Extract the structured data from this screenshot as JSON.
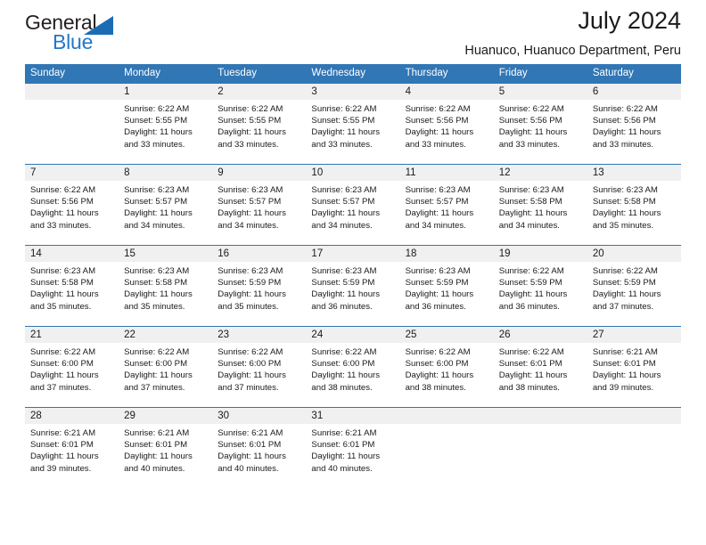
{
  "brand": {
    "name_top": "General",
    "name_bottom": "Blue",
    "triangle_icon": "triangle-icon",
    "colors": {
      "general_text": "#231f20",
      "blue_text": "#2277c8",
      "triangle": "#1b6cb5"
    }
  },
  "header": {
    "title": "July 2024",
    "subtitle": "Huanuco, Huanuco Department, Peru"
  },
  "theme": {
    "header_blue": "#3176b5",
    "daynum_band": "#f0f0f0",
    "text": "#1a1a1a"
  },
  "weekdays": [
    "Sunday",
    "Monday",
    "Tuesday",
    "Wednesday",
    "Thursday",
    "Friday",
    "Saturday"
  ],
  "weeks": [
    {
      "days": [
        {
          "num": "",
          "sunrise": "",
          "sunset": "",
          "daylight": ""
        },
        {
          "num": "1",
          "sunrise": "Sunrise: 6:22 AM",
          "sunset": "Sunset: 5:55 PM",
          "daylight": "Daylight: 11 hours and 33 minutes."
        },
        {
          "num": "2",
          "sunrise": "Sunrise: 6:22 AM",
          "sunset": "Sunset: 5:55 PM",
          "daylight": "Daylight: 11 hours and 33 minutes."
        },
        {
          "num": "3",
          "sunrise": "Sunrise: 6:22 AM",
          "sunset": "Sunset: 5:55 PM",
          "daylight": "Daylight: 11 hours and 33 minutes."
        },
        {
          "num": "4",
          "sunrise": "Sunrise: 6:22 AM",
          "sunset": "Sunset: 5:56 PM",
          "daylight": "Daylight: 11 hours and 33 minutes."
        },
        {
          "num": "5",
          "sunrise": "Sunrise: 6:22 AM",
          "sunset": "Sunset: 5:56 PM",
          "daylight": "Daylight: 11 hours and 33 minutes."
        },
        {
          "num": "6",
          "sunrise": "Sunrise: 6:22 AM",
          "sunset": "Sunset: 5:56 PM",
          "daylight": "Daylight: 11 hours and 33 minutes."
        }
      ]
    },
    {
      "days": [
        {
          "num": "7",
          "sunrise": "Sunrise: 6:22 AM",
          "sunset": "Sunset: 5:56 PM",
          "daylight": "Daylight: 11 hours and 33 minutes."
        },
        {
          "num": "8",
          "sunrise": "Sunrise: 6:23 AM",
          "sunset": "Sunset: 5:57 PM",
          "daylight": "Daylight: 11 hours and 34 minutes."
        },
        {
          "num": "9",
          "sunrise": "Sunrise: 6:23 AM",
          "sunset": "Sunset: 5:57 PM",
          "daylight": "Daylight: 11 hours and 34 minutes."
        },
        {
          "num": "10",
          "sunrise": "Sunrise: 6:23 AM",
          "sunset": "Sunset: 5:57 PM",
          "daylight": "Daylight: 11 hours and 34 minutes."
        },
        {
          "num": "11",
          "sunrise": "Sunrise: 6:23 AM",
          "sunset": "Sunset: 5:57 PM",
          "daylight": "Daylight: 11 hours and 34 minutes."
        },
        {
          "num": "12",
          "sunrise": "Sunrise: 6:23 AM",
          "sunset": "Sunset: 5:58 PM",
          "daylight": "Daylight: 11 hours and 34 minutes."
        },
        {
          "num": "13",
          "sunrise": "Sunrise: 6:23 AM",
          "sunset": "Sunset: 5:58 PM",
          "daylight": "Daylight: 11 hours and 35 minutes."
        }
      ]
    },
    {
      "days": [
        {
          "num": "14",
          "sunrise": "Sunrise: 6:23 AM",
          "sunset": "Sunset: 5:58 PM",
          "daylight": "Daylight: 11 hours and 35 minutes."
        },
        {
          "num": "15",
          "sunrise": "Sunrise: 6:23 AM",
          "sunset": "Sunset: 5:58 PM",
          "daylight": "Daylight: 11 hours and 35 minutes."
        },
        {
          "num": "16",
          "sunrise": "Sunrise: 6:23 AM",
          "sunset": "Sunset: 5:59 PM",
          "daylight": "Daylight: 11 hours and 35 minutes."
        },
        {
          "num": "17",
          "sunrise": "Sunrise: 6:23 AM",
          "sunset": "Sunset: 5:59 PM",
          "daylight": "Daylight: 11 hours and 36 minutes."
        },
        {
          "num": "18",
          "sunrise": "Sunrise: 6:23 AM",
          "sunset": "Sunset: 5:59 PM",
          "daylight": "Daylight: 11 hours and 36 minutes."
        },
        {
          "num": "19",
          "sunrise": "Sunrise: 6:22 AM",
          "sunset": "Sunset: 5:59 PM",
          "daylight": "Daylight: 11 hours and 36 minutes."
        },
        {
          "num": "20",
          "sunrise": "Sunrise: 6:22 AM",
          "sunset": "Sunset: 5:59 PM",
          "daylight": "Daylight: 11 hours and 37 minutes."
        }
      ]
    },
    {
      "days": [
        {
          "num": "21",
          "sunrise": "Sunrise: 6:22 AM",
          "sunset": "Sunset: 6:00 PM",
          "daylight": "Daylight: 11 hours and 37 minutes."
        },
        {
          "num": "22",
          "sunrise": "Sunrise: 6:22 AM",
          "sunset": "Sunset: 6:00 PM",
          "daylight": "Daylight: 11 hours and 37 minutes."
        },
        {
          "num": "23",
          "sunrise": "Sunrise: 6:22 AM",
          "sunset": "Sunset: 6:00 PM",
          "daylight": "Daylight: 11 hours and 37 minutes."
        },
        {
          "num": "24",
          "sunrise": "Sunrise: 6:22 AM",
          "sunset": "Sunset: 6:00 PM",
          "daylight": "Daylight: 11 hours and 38 minutes."
        },
        {
          "num": "25",
          "sunrise": "Sunrise: 6:22 AM",
          "sunset": "Sunset: 6:00 PM",
          "daylight": "Daylight: 11 hours and 38 minutes."
        },
        {
          "num": "26",
          "sunrise": "Sunrise: 6:22 AM",
          "sunset": "Sunset: 6:01 PM",
          "daylight": "Daylight: 11 hours and 38 minutes."
        },
        {
          "num": "27",
          "sunrise": "Sunrise: 6:21 AM",
          "sunset": "Sunset: 6:01 PM",
          "daylight": "Daylight: 11 hours and 39 minutes."
        }
      ]
    },
    {
      "days": [
        {
          "num": "28",
          "sunrise": "Sunrise: 6:21 AM",
          "sunset": "Sunset: 6:01 PM",
          "daylight": "Daylight: 11 hours and 39 minutes."
        },
        {
          "num": "29",
          "sunrise": "Sunrise: 6:21 AM",
          "sunset": "Sunset: 6:01 PM",
          "daylight": "Daylight: 11 hours and 40 minutes."
        },
        {
          "num": "30",
          "sunrise": "Sunrise: 6:21 AM",
          "sunset": "Sunset: 6:01 PM",
          "daylight": "Daylight: 11 hours and 40 minutes."
        },
        {
          "num": "31",
          "sunrise": "Sunrise: 6:21 AM",
          "sunset": "Sunset: 6:01 PM",
          "daylight": "Daylight: 11 hours and 40 minutes."
        },
        {
          "num": "",
          "sunrise": "",
          "sunset": "",
          "daylight": ""
        },
        {
          "num": "",
          "sunrise": "",
          "sunset": "",
          "daylight": ""
        },
        {
          "num": "",
          "sunrise": "",
          "sunset": "",
          "daylight": ""
        }
      ]
    }
  ]
}
